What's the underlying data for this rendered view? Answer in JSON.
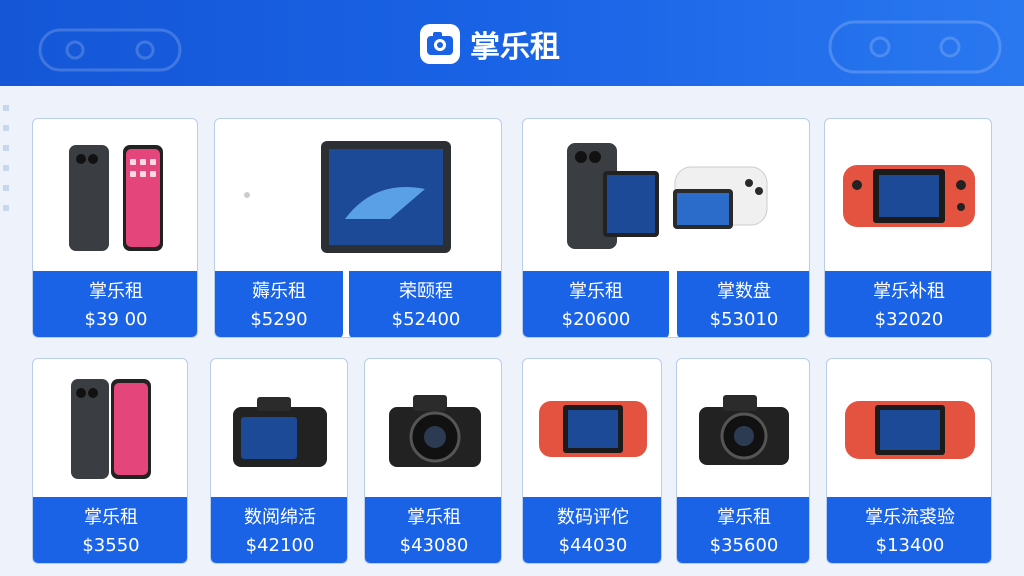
{
  "brand": {
    "name": "掌乐租"
  },
  "row1": [
    {
      "title": "掌乐租",
      "price": "$39 00"
    },
    {
      "title": "薅乐租",
      "price": "$5290"
    },
    {
      "title": "荣颐程",
      "price": "$52400"
    },
    {
      "title": "掌乐租",
      "price": "$20600"
    },
    {
      "title": "掌数盘",
      "price": "$53010"
    },
    {
      "title": "掌乐补租",
      "price": "$32020"
    }
  ],
  "row2": [
    {
      "title": "掌乐租",
      "price": "$3550"
    },
    {
      "title": "数阅绵活",
      "price": "$42100"
    },
    {
      "title": "掌乐租",
      "price": "$43080"
    },
    {
      "title": "数码评佗",
      "price": "$44030"
    },
    {
      "title": "掌乐租",
      "price": "$35600"
    },
    {
      "title": "掌乐流裘验",
      "price": "$13400"
    }
  ],
  "icons": {
    "logo": "camera-logo-icon",
    "phones": "smartphone-icon",
    "tablet": "tablet-icon",
    "controller": "game-controller-icon",
    "handheld": "handheld-console-icon",
    "camera": "camera-icon"
  },
  "colors": {
    "accent": "#1a63e6",
    "background": "#eef3fb",
    "card_border": "#b9cdea"
  }
}
